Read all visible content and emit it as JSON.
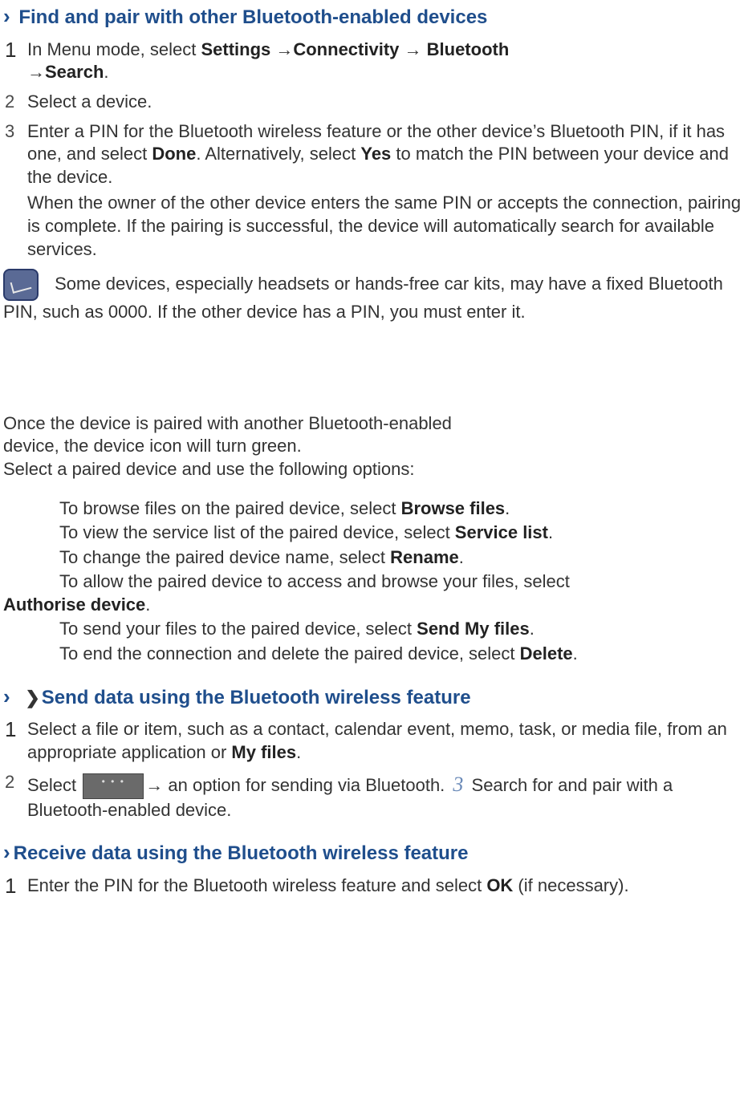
{
  "section1": {
    "title": "Find and pair with other Bluetooth-enabled devices",
    "step1_pre": "In Menu mode, select ",
    "step1_b1": "Settings ",
    "step1_arrow1": "→",
    "step1_b2": "Connectivity ",
    "step1_arrow2": "→ ",
    "step1_b3": "Bluetooth ",
    "step1_arrow3": "→",
    "step1_b4": "Search",
    "step1_post": ".",
    "step2": "Select a device.",
    "step3_a": "Enter a PIN for the Bluetooth wireless feature or the other device’s Bluetooth PIN, if it has one, and select ",
    "step3_done": "Done",
    "step3_b": ". Alternatively, select ",
    "step3_yes": "Yes",
    "step3_c": " to match the PIN between your device and the device.",
    "step3_d": "When the owner of the other device enters the same PIN or accepts the connection, pairing is complete. If the pairing is successful, the device will automatically search for available services.",
    "note": "Some devices, especially headsets or hands-free car kits, may have a fixed Bluetooth PIN, such as 0000. If the other device has a PIN, you must enter it."
  },
  "between": {
    "p1": "Once the device is paired with another Bluetooth-enabled",
    "p2": "device, the device icon will turn green.",
    "p3": "Select a paired device and use the following options:"
  },
  "options": {
    "o1_a": "To browse files on the paired device, select ",
    "o1_b": "Browse files",
    "o1_c": ".",
    "o2_a": "To view the service list of the paired device, select ",
    "o2_b": "Service list",
    "o2_c": ".",
    "o3_a": "To change the paired device name, select ",
    "o3_b": "Rename",
    "o3_c": ".",
    "o4_a": "To allow the paired device to access and browse your files, select ",
    "o4_b": "Authorise device",
    "o4_c": ".",
    "o5_a": "To send your files to the paired device, select ",
    "o5_b": "Send My files",
    "o5_c": ".",
    "o6_a": "To end the connection and delete the paired device, select ",
    "o6_b": "Delete",
    "o6_c": "."
  },
  "section2": {
    "title": "Send data using the Bluetooth wireless feature",
    "step1_a": "Select a file or item, such as a contact, calendar event, memo, task, or media file, from an appropriate application or ",
    "step1_b": "My files",
    "step1_c": ".",
    "step2_a": "Select  ",
    "step2_b": "→ an option for sending via Bluetooth. ",
    "step2_num": "3",
    "step2_c": " Search for and pair with a Bluetooth-enabled device."
  },
  "section3": {
    "title": "Receive data using the Bluetooth wireless feature",
    "step1_a": "Enter the PIN for the Bluetooth wireless feature and select ",
    "step1_b": "OK",
    "step1_c": " (if necessary)."
  },
  "nums": {
    "n1": "1",
    "n2": "2",
    "n3": "3"
  },
  "glyphs": {
    "chevron": "›"
  }
}
